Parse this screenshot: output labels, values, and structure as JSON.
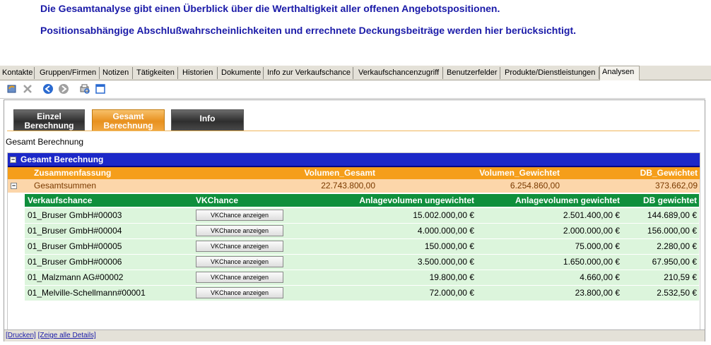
{
  "intro": {
    "line1": "Die Gesamtanalyse gibt einen Überblick über die Werthaltigkeit aller offenen Angebotspositionen.",
    "line2": "Positionsabhängige Abschlußwahrscheinlichkeiten und errechnete Deckungsbeiträge werden hier berücksichtigt."
  },
  "tabs": [
    {
      "label": "Kontakte"
    },
    {
      "label": "Gruppen/Firmen"
    },
    {
      "label": "Notizen"
    },
    {
      "label": "Tätigkeiten"
    },
    {
      "label": "Historien"
    },
    {
      "label": "Dokumente"
    },
    {
      "label": "Info zur Verkaufschance"
    },
    {
      "label": "Verkaufschancenzugriff"
    },
    {
      "label": "Benutzerfelder"
    },
    {
      "label": "Produkte/Dienstleistungen"
    },
    {
      "label": "Analysen"
    }
  ],
  "active_tab": "Analysen",
  "toolbar": {
    "icons": [
      "refresh-icon",
      "delete-icon",
      "back-icon",
      "forward-icon",
      "print-preview-icon",
      "window-icon"
    ]
  },
  "buttons": {
    "einzel": {
      "line1": "Einzel",
      "line2": "Berechnung"
    },
    "gesamt": {
      "line1": "Gesamt",
      "line2": "Berechnung"
    },
    "info": {
      "label": "Info"
    }
  },
  "section_title": "Gesamt Berechnung",
  "grid": {
    "title": "Gesamt Berechnung",
    "summary_headers": {
      "zusammenfassung": "Zusammenfassung",
      "volumen_gesamt": "Volumen_Gesamt",
      "volumen_gewichtet": "Volumen_Gewichtet",
      "db_gewichtet": "DB_Gewichtet"
    },
    "summary_row": {
      "label": "Gesamtsummen",
      "volumen_gesamt": "22.743.800,00",
      "volumen_gewichtet": "6.254.860,00",
      "db_gewichtet": "373.662,09"
    },
    "detail_headers": {
      "verkaufschance": "Verkaufschance",
      "vkchance": "VKChance",
      "anlage_ungewichtet": "Anlagevolumen ungewichtet",
      "anlage_gewichtet": "Anlagevolumen gewichtet",
      "db_gewichtet": "DB gewichtet"
    },
    "rows": [
      {
        "name": "01_Bruser GmbH#00003",
        "button": "VKChance anzeigen",
        "ungewichtet": "15.002.000,00 €",
        "gewichtet": "2.501.400,00 €",
        "db": "144.689,00 €"
      },
      {
        "name": "01_Bruser GmbH#00004",
        "button": "VKChance anzeigen",
        "ungewichtet": "4.000.000,00 €",
        "gewichtet": "2.000.000,00 €",
        "db": "156.000,00 €"
      },
      {
        "name": "01_Bruser GmbH#00005",
        "button": "VKChance anzeigen",
        "ungewichtet": "150.000,00 €",
        "gewichtet": "75.000,00 €",
        "db": "2.280,00 €"
      },
      {
        "name": "01_Bruser GmbH#00006",
        "button": "VKChance anzeigen",
        "ungewichtet": "3.500.000,00 €",
        "gewichtet": "1.650.000,00 €",
        "db": "67.950,00 €"
      },
      {
        "name": "01_Malzmann AG#00002",
        "button": "VKChance anzeigen",
        "ungewichtet": "19.800,00 €",
        "gewichtet": "4.660,00 €",
        "db": "210,59 €"
      },
      {
        "name": "01_Melville-Schellmann#00001",
        "button": "VKChance anzeigen",
        "ungewichtet": "72.000,00 €",
        "gewichtet": "23.800,00 €",
        "db": "2.532,50 €"
      }
    ]
  },
  "footer": {
    "drucken": "[Drucken]",
    "details": "[Zeige alle Details]"
  }
}
